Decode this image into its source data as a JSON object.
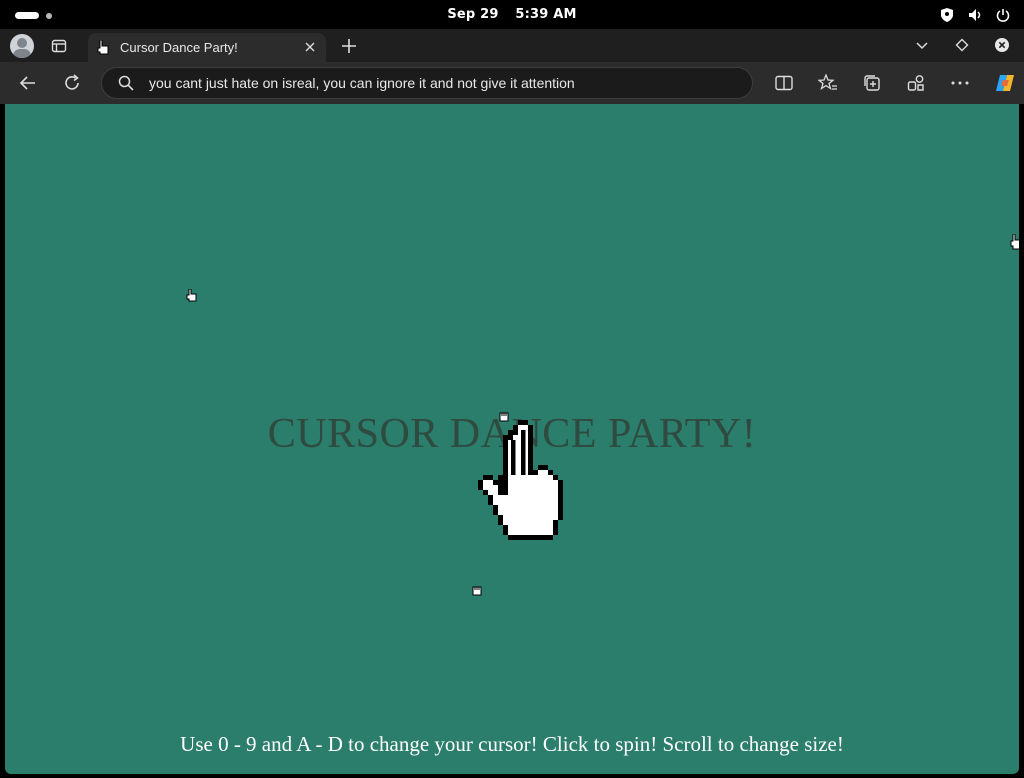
{
  "system": {
    "date": "Sep 29",
    "time": "5:39 AM"
  },
  "browser": {
    "tab_title": "Cursor Dance Party!",
    "address_text": "you cant just hate on isreal, you can ignore it and not give it attention",
    "icons": [
      "profile-icon",
      "tab-actions-icon",
      "close-icon",
      "new-tab-icon",
      "chevron-down-icon",
      "diamond-icon",
      "close-circle-icon",
      "back-icon",
      "refresh-icon",
      "search-icon",
      "split-screen-icon",
      "favorites-icon",
      "collections-icon",
      "extensions-icon",
      "more-icon",
      "copilot-icon"
    ]
  },
  "page": {
    "heading": "CURSOR DANCE PARTY!",
    "instructions": "Use 0 - 9 and A - D to change your cursor! Click to spin! Scroll to change size!",
    "background": "#2b7d6c",
    "heading_color": "#2f4a3f"
  }
}
